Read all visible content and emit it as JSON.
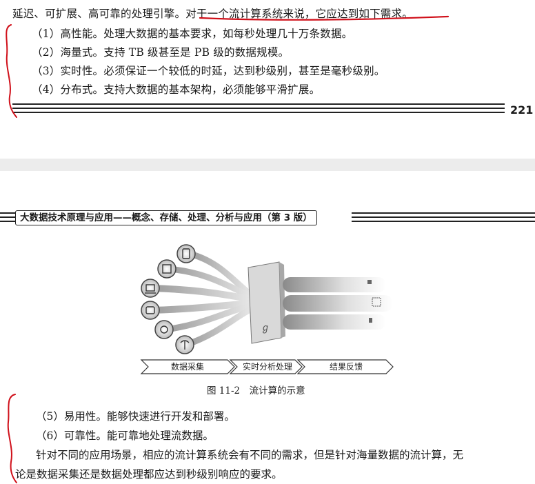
{
  "top_page": {
    "first_line": "延迟、可扩展、高可靠的处理引擎。对于一个流计算系统来说，它应达到如下需求。",
    "items": [
      "（1）高性能。处理大数据的基本要求，如每秒处理几十万条数据。",
      "（2）海量式。支持 TB 级甚至是 PB 级的数据规模。",
      "（3）实时性。必须保证一个较低的时延，达到秒级别，甚至是毫秒级别。",
      "（4）分布式。支持大数据的基本架构，必须能够平滑扩展。"
    ],
    "page_number": "221"
  },
  "bottom_page": {
    "running_header": "大数据技术原理与应用——概念、存储、处理、分析与应用（第 3 版）",
    "figure": {
      "stages": [
        "数据采集",
        "实时分析处理",
        "结果反馈"
      ],
      "caption": "图 11-2　流计算的示意"
    },
    "items": [
      "（5）易用性。能够快速进行开发和部署。",
      "（6）可靠性。能可靠地处理流数据。"
    ],
    "paragraph_line1": "针对不同的应用场景，相应的流计算系统会有不同的需求，但是针对海量数据的流计算，无",
    "paragraph_line2": "论是数据采集还是数据处理都应达到秒级别响应的要求。"
  },
  "colors": {
    "annotation": "#d0101a",
    "rule": "#222222",
    "gap": "#ececec"
  }
}
